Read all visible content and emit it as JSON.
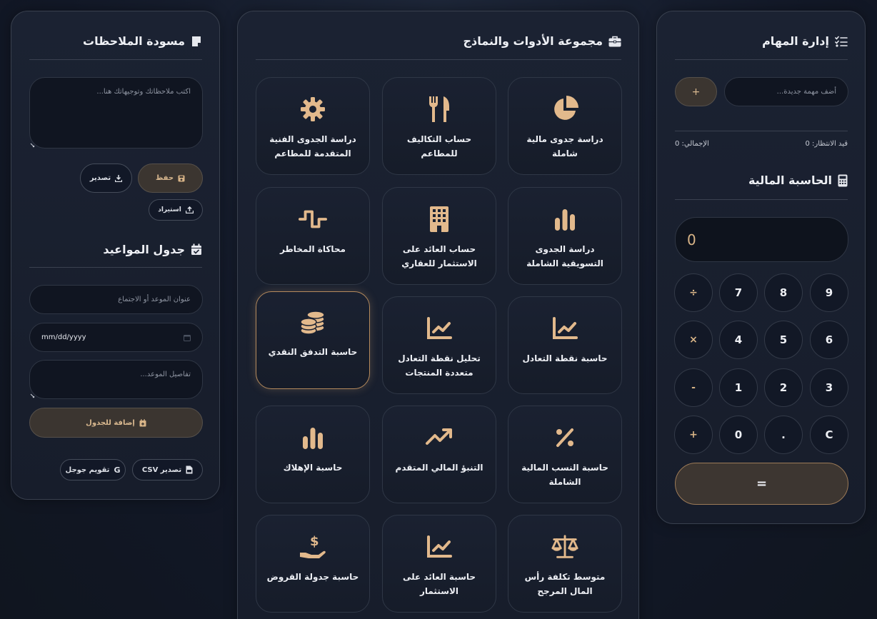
{
  "notes": {
    "title": "مسودة الملاحظات",
    "placeholder": "اكتب ملاحظاتك وتوجيهاتك هنا...",
    "save_label": "حفظ",
    "export_label": "تصدير",
    "import_label": "استيراد"
  },
  "schedule": {
    "title": "جدول المواعيد",
    "title_placeholder": "عنوان الموعد أو الاجتماع",
    "date_value": "mm/dd/yyyy",
    "details_placeholder": "تفاصيل الموعد...",
    "add_label": "إضافة للجدول",
    "export_csv_label": "تصدير CSV",
    "google_calendar_label": "تقويم جوجل"
  },
  "tools": {
    "title": "مجموعة الأدوات والنماذج",
    "items": [
      {
        "label": "دراسة جدوى مالية شاملة",
        "icon": "pie-chart-icon"
      },
      {
        "label": "حساب التكاليف للمطاعم",
        "icon": "utensils-icon"
      },
      {
        "label": "دراسة الجدوى الفنية المتقدمة للمطاعم",
        "icon": "gear-icon"
      },
      {
        "label": "دراسة الجدوى التسويقية الشاملة",
        "icon": "bar-chart-icon"
      },
      {
        "label": "حساب العائد على الاستثمار للعقاري",
        "icon": "building-icon"
      },
      {
        "label": "محاكاة المخاطر",
        "icon": "wave-icon"
      },
      {
        "label": "حاسبة نقطة التعادل",
        "icon": "line-chart-icon"
      },
      {
        "label": "تحليل نقطة التعادل متعددة المنتجات",
        "icon": "line-chart-icon"
      },
      {
        "label": "حاسبة التدفق النقدي",
        "icon": "coins-icon"
      },
      {
        "label": "حاسبة النسب المالية الشاملة",
        "icon": "percent-icon"
      },
      {
        "label": "التنبؤ المالي المتقدم",
        "icon": "trend-up-icon"
      },
      {
        "label": "حاسبة الإهلاك",
        "icon": "bar-chart-icon"
      },
      {
        "label": "متوسط تكلفة رأس المال المرجح",
        "icon": "scale-icon"
      },
      {
        "label": "حاسبة العائد على الاستثمار",
        "icon": "line-chart-icon"
      },
      {
        "label": "حاسبة جدولة القروض",
        "icon": "hand-dollar-icon"
      }
    ]
  },
  "tasks": {
    "title": "إدارة المهام",
    "input_placeholder": "أضف مهمة جديدة...",
    "add_label": "+",
    "pending": "قيد الانتظار: 0",
    "total": "الإجمالي: 0"
  },
  "calculator": {
    "title": "الحاسبة المالية",
    "display": "0",
    "keys": [
      "9",
      "8",
      "7",
      "÷",
      "6",
      "5",
      "4",
      "×",
      "3",
      "2",
      "1",
      "-",
      "C",
      ".",
      "0",
      "+"
    ],
    "equals": "="
  },
  "colors": {
    "accent": "#d8b487",
    "panel_bg": "#1a2131",
    "page_bg": "#121827"
  }
}
